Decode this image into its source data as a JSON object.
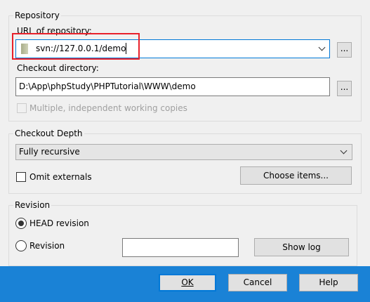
{
  "repository": {
    "group_label": "Repository",
    "url_label": "URL of repository:",
    "url_value": "svn://127.0.0.1/demo",
    "browse_label": "...",
    "checkout_dir_label": "Checkout directory:",
    "checkout_dir_value": "D:\\App\\phpStudy\\PHPTutorial\\WWW\\demo",
    "browse_dir_label": "...",
    "multiple_copies_label": "Multiple, independent working copies"
  },
  "depth": {
    "group_label": "Checkout Depth",
    "selected": "Fully recursive",
    "omit_externals_label": "Omit externals",
    "choose_items_label": "Choose items..."
  },
  "revision": {
    "group_label": "Revision",
    "head_label": "HEAD revision",
    "revision_label": "Revision",
    "revision_value": "",
    "show_log_label": "Show log"
  },
  "footer": {
    "ok_label": "OK",
    "cancel_label": "Cancel",
    "help_label": "Help"
  },
  "colors": {
    "highlight": "#e8212b",
    "footer_bg": "#1a82d6",
    "focus": "#0078d7"
  }
}
